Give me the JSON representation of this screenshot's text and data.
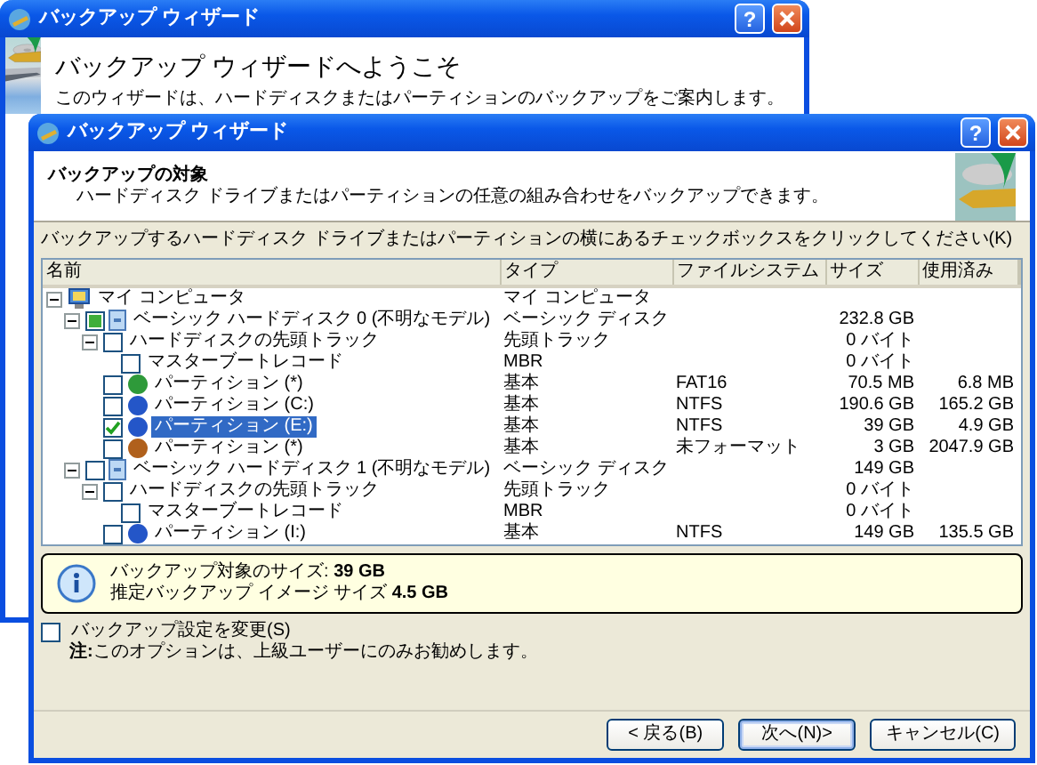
{
  "back_window": {
    "title": "バックアップ ウィザード",
    "help_button": "?",
    "heading": "バックアップ ウィザードへようこそ",
    "description": "このウィザードは、ハードディスクまたはパーティションのバックアップをご案内します。"
  },
  "front_window": {
    "title": "バックアップ ウィザード",
    "help_button": "?",
    "header_title": "バックアップの対象",
    "header_subtitle": "ハードディスク ドライブまたはパーティションの任意の組み合わせをバックアップできます。",
    "instruction": "バックアップするハードディスク ドライブまたはパーティションの横にあるチェックボックスをクリックしてください(K)",
    "tree": {
      "columns": [
        "名前",
        "タイプ",
        "ファイルシステム",
        "サイズ",
        "使用済み"
      ],
      "items": [
        {
          "kind": "computer",
          "name": "マイ コンピュータ",
          "type": "マイ コンピュータ",
          "expanded": true,
          "selected": false,
          "children": [
            {
              "kind": "disk",
              "name": "ベーシック ハードディスク 0 (不明なモデル)",
              "type": "ベーシック ディスク",
              "size": "232.8 GB",
              "checked": false,
              "partial": true,
              "expanded": true,
              "selected": false,
              "children": [
                {
                  "name": "ハードディスクの先頭トラック",
                  "type": "先頭トラック",
                  "size": "0 バイト",
                  "checked": false,
                  "partial": false,
                  "expanded": true,
                  "selected": false,
                  "children": [
                    {
                      "name": "マスターブートレコード",
                      "type": "MBR",
                      "size": "0 バイト",
                      "checked": false,
                      "partial": false,
                      "selected": false
                    }
                  ]
                },
                {
                  "kind": "partition",
                  "name": "パーティション (*)",
                  "type": "基本",
                  "filesystem": "FAT16",
                  "size": "70.5 MB",
                  "used": "6.8 MB",
                  "color": "#2e9a3a",
                  "checked": false,
                  "partial": false,
                  "selected": false
                },
                {
                  "kind": "partition",
                  "name": "パーティション (C:)",
                  "type": "基本",
                  "filesystem": "NTFS",
                  "size": "190.6 GB",
                  "used": "165.2 GB",
                  "color": "#2456c8",
                  "checked": false,
                  "partial": false,
                  "selected": false
                },
                {
                  "kind": "partition",
                  "name": "パーティション (E:)",
                  "type": "基本",
                  "filesystem": "NTFS",
                  "size": "39 GB",
                  "used": "4.9 GB",
                  "color": "#2456c8",
                  "checked": true,
                  "partial": false,
                  "selected": true
                },
                {
                  "kind": "partition",
                  "name": "パーティション (*)",
                  "type": "基本",
                  "filesystem": "未フォーマット",
                  "size": "3 GB",
                  "used": "2047.9 GB",
                  "color": "#b0601c",
                  "checked": false,
                  "partial": false,
                  "selected": false
                }
              ]
            },
            {
              "kind": "disk",
              "name": "ベーシック ハードディスク 1 (不明なモデル)",
              "type": "ベーシック ディスク",
              "size": "149 GB",
              "checked": false,
              "partial": false,
              "expanded": true,
              "selected": false,
              "children": [
                {
                  "name": "ハードディスクの先頭トラック",
                  "type": "先頭トラック",
                  "size": "0 バイト",
                  "checked": false,
                  "partial": false,
                  "expanded": true,
                  "selected": false,
                  "children": [
                    {
                      "name": "マスターブートレコード",
                      "type": "MBR",
                      "size": "0 バイト",
                      "checked": false,
                      "partial": false,
                      "selected": false
                    }
                  ]
                },
                {
                  "kind": "partition",
                  "name": "パーティション (I:)",
                  "type": "基本",
                  "filesystem": "NTFS",
                  "size": "149 GB",
                  "used": "135.5 GB",
                  "color": "#2456c8",
                  "checked": false,
                  "partial": false,
                  "selected": false
                }
              ]
            }
          ]
        }
      ]
    },
    "info": [
      "バックアップ対象のサイズ: **39 GB**",
      "推定バックアップ イメージ サイズ **4.5 GB**"
    ],
    "option": {
      "label": "バックアップ設定を変更(S)",
      "checked": false
    },
    "note": "**注:**このオプションは、上級ユーザーにのみお勧めします。",
    "buttons": [
      {
        "label": "< 戻る(B)",
        "default": false
      },
      {
        "label": "次へ(N)>",
        "default": true
      },
      {
        "label": "キャンセル(C)",
        "default": false
      }
    ]
  }
}
